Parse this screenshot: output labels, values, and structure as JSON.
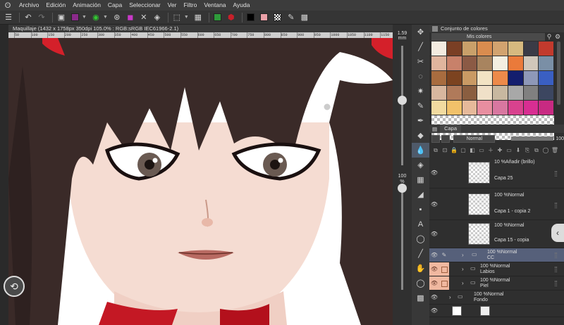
{
  "menu": {
    "items": [
      "Archivo",
      "Edición",
      "Animación",
      "Capa",
      "Seleccionar",
      "Ver",
      "Filtro",
      "Ventana",
      "Ayuda"
    ]
  },
  "toolbar": {
    "icons": [
      "hamburger-menu-icon",
      "undo-icon",
      "redo-icon",
      "new-canvas-icon",
      "color-icon",
      "target-icon",
      "settings-icon",
      "brush-color-icon",
      "clear-icon",
      "layers-icon",
      "transform-icon",
      "select-icon",
      "fill-icon",
      "color-swatch-black",
      "color-swatch-pink",
      "transparent-swatch",
      "eyedropper-icon",
      "grid-icon"
    ],
    "colors": {
      "green": "#2e9a3a",
      "red": "#c8202a",
      "black": "#000000",
      "pink": "#e9a0a8",
      "purple": "#8a2a8a",
      "green_tool": "#32c832"
    }
  },
  "document": {
    "title": "Maquillaje (1432 x 1758px 350dpi 105.0% : RGB:sRGB IEC61966-2.1)",
    "ruler_ticks": [
      "50",
      "100",
      "150",
      "200",
      "250",
      "300",
      "350",
      "400",
      "450",
      "500",
      "550",
      "600",
      "650",
      "700",
      "750",
      "800",
      "850",
      "900",
      "950",
      "1000",
      "1050",
      "1100",
      "1150"
    ]
  },
  "sidebar": {
    "brush_size": "1.59",
    "brush_unit": "mm",
    "opacity": "100",
    "opacity_unit": "%",
    "brush_size_level": 0.55,
    "opacity_level": 1.0
  },
  "color_set": {
    "panel_title": "Conjunto de colores",
    "set_name": "Mis colores",
    "colors": [
      "#f3ebe0",
      "#7a3f25",
      "#c9a06a",
      "#d98c4f",
      "#d2a36f",
      "#d6b97f",
      "#3a3b46",
      "#c23a2d",
      "#e0b59e",
      "#c8816a",
      "#8b5a45",
      "#a8845f",
      "#f4efe1",
      "#ea7a3a",
      "#d0c7ba",
      "#7a8fa6",
      "#a86c3f",
      "#7c4320",
      "#c99a64",
      "#f2e3c4",
      "#ed8a4a",
      "#141e6e",
      "#8e98b8",
      "#3a5fc2",
      "#d8b79f",
      "#b07a5a",
      "#8a5e40",
      "#f0e0c8",
      "#c8b8a0",
      "#a8a8a8",
      "#808080",
      "#3c4660",
      "#f2dba0",
      "#f1c16a",
      "#e6b99a",
      "#e88ea0",
      "#d877a0",
      "#d8428e",
      "#d82e92",
      "#c82a82"
    ]
  },
  "layer_panel": {
    "tab": "Capa",
    "blend_mode": "Normal",
    "opacity_value": "100",
    "layers": [
      {
        "mode": "10 %Añadir (brillo)",
        "name": "Capa 25",
        "type": "raster"
      },
      {
        "mode": "100 %Normal",
        "name": "Capa 1 - copia 2",
        "type": "raster"
      },
      {
        "mode": "100 %Normal",
        "name": "Capa 15 - copia",
        "type": "raster"
      },
      {
        "mode": "100 %Normal",
        "name": "CC",
        "type": "folder",
        "selected": true
      },
      {
        "mode": "100 %Normal",
        "name": "Labios",
        "type": "folder"
      },
      {
        "mode": "100 %Normal",
        "name": "Piel",
        "type": "folder"
      },
      {
        "mode": "100 %Normal",
        "name": "Fondo",
        "type": "folder"
      }
    ]
  },
  "tools": [
    "move-icon",
    "line-icon",
    "brush-icon",
    "lasso-icon",
    "sparkle-icon",
    "eyedropper-icon",
    "pen-icon",
    "eraser-icon",
    "blend-icon",
    "fill-icon",
    "grid-icon",
    "gradient-icon",
    "figure-icon",
    "text-icon",
    "balloon-icon",
    "ruler-icon",
    "hand-icon",
    "color-circle-icon",
    "checker-icon"
  ]
}
